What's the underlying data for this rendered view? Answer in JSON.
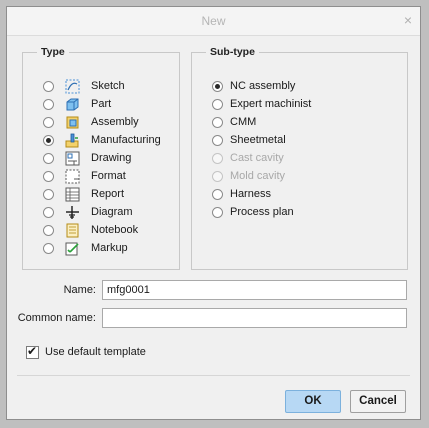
{
  "dialog": {
    "title": "New",
    "close_glyph": "×"
  },
  "type_group": {
    "label": "Type",
    "items": [
      {
        "label": "Sketch",
        "icon": "sketch-icon",
        "selected": false
      },
      {
        "label": "Part",
        "icon": "part-icon",
        "selected": false
      },
      {
        "label": "Assembly",
        "icon": "assembly-icon",
        "selected": false
      },
      {
        "label": "Manufacturing",
        "icon": "manufacturing-icon",
        "selected": true
      },
      {
        "label": "Drawing",
        "icon": "drawing-icon",
        "selected": false
      },
      {
        "label": "Format",
        "icon": "format-icon",
        "selected": false
      },
      {
        "label": "Report",
        "icon": "report-icon",
        "selected": false
      },
      {
        "label": "Diagram",
        "icon": "diagram-icon",
        "selected": false
      },
      {
        "label": "Notebook",
        "icon": "notebook-icon",
        "selected": false
      },
      {
        "label": "Markup",
        "icon": "markup-icon",
        "selected": false
      }
    ]
  },
  "subtype_group": {
    "label": "Sub-type",
    "items": [
      {
        "label": "NC assembly",
        "selected": true,
        "enabled": true
      },
      {
        "label": "Expert machinist",
        "selected": false,
        "enabled": true
      },
      {
        "label": "CMM",
        "selected": false,
        "enabled": true
      },
      {
        "label": "Sheetmetal",
        "selected": false,
        "enabled": true
      },
      {
        "label": "Cast cavity",
        "selected": false,
        "enabled": false
      },
      {
        "label": "Mold cavity",
        "selected": false,
        "enabled": false
      },
      {
        "label": "Harness",
        "selected": false,
        "enabled": true
      },
      {
        "label": "Process plan",
        "selected": false,
        "enabled": true
      }
    ]
  },
  "fields": {
    "name_label": "Name:",
    "name_value": "mfg0001",
    "common_name_label": "Common name:",
    "common_name_value": ""
  },
  "options": {
    "use_default_template_label": "Use default template",
    "use_default_template_checked": true
  },
  "buttons": {
    "ok_label": "OK",
    "cancel_label": "Cancel"
  },
  "colors": {
    "ok_button_bg": "#b7d8f4",
    "icon_accent_blue": "#4a8fd6",
    "icon_accent_yellow": "#e9b534"
  }
}
